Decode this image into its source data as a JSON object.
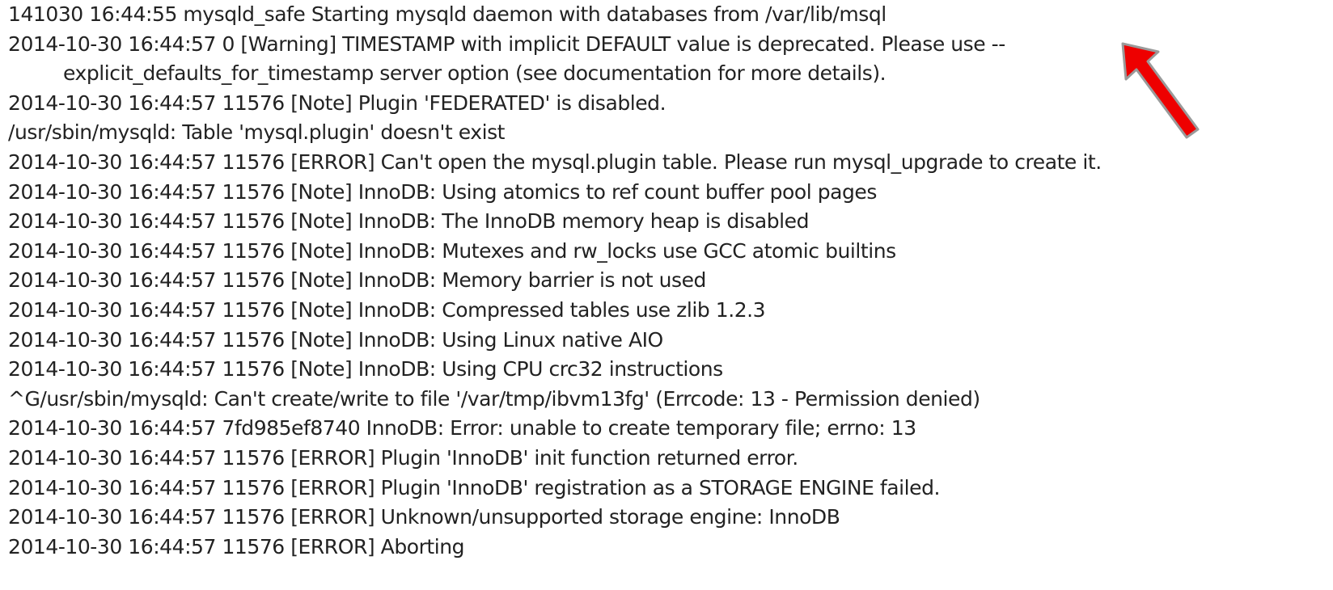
{
  "log_lines": [
    "141030 16:44:55 mysqld_safe Starting mysqld daemon with databases from /var/lib/msql",
    "2014-10-30 16:44:57 0 [Warning] TIMESTAMP with implicit DEFAULT value is deprecated. Please use --",
    "explicit_defaults_for_timestamp server option (see documentation for more details).",
    "2014-10-30 16:44:57 11576 [Note] Plugin 'FEDERATED' is disabled.",
    "/usr/sbin/mysqld: Table 'mysql.plugin' doesn't exist",
    "2014-10-30 16:44:57 11576 [ERROR] Can't open the mysql.plugin table. Please run mysql_upgrade to create it.",
    "2014-10-30 16:44:57 11576 [Note] InnoDB: Using atomics to ref count buffer pool pages",
    "2014-10-30 16:44:57 11576 [Note] InnoDB: The InnoDB memory heap is disabled",
    "2014-10-30 16:44:57 11576 [Note] InnoDB: Mutexes and rw_locks use GCC atomic builtins",
    "2014-10-30 16:44:57 11576 [Note] InnoDB: Memory barrier is not used",
    "2014-10-30 16:44:57 11576 [Note] InnoDB: Compressed tables use zlib 1.2.3",
    "2014-10-30 16:44:57 11576 [Note] InnoDB: Using Linux native AIO",
    "2014-10-30 16:44:57 11576 [Note] InnoDB: Using CPU crc32 instructions",
    "^G/usr/sbin/mysqld: Can't create/write to file '/var/tmp/ibvm13fg' (Errcode: 13 - Permission denied)",
    "2014-10-30 16:44:57 7fd985ef8740  InnoDB: Error: unable to create temporary file; errno: 13",
    "2014-10-30 16:44:57 11576 [ERROR] Plugin 'InnoDB' init function returned error.",
    "2014-10-30 16:44:57 11576 [ERROR] Plugin 'InnoDB' registration as a STORAGE ENGINE failed.",
    "2014-10-30 16:44:57 11576 [ERROR] Unknown/unsupported storage engine: InnoDB",
    "2014-10-30 16:44:57 11576 [ERROR] Aborting"
  ],
  "annotation": {
    "icon": "red-arrow-icon",
    "fill_color": "#ee0000",
    "outline_color": "#9a9a9a"
  }
}
